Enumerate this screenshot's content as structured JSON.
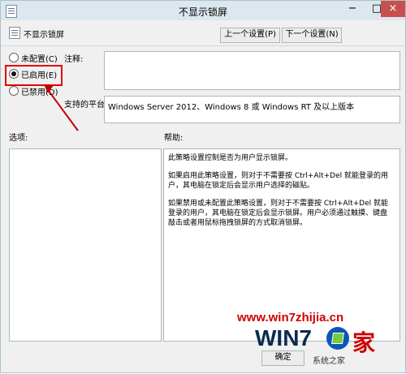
{
  "window": {
    "title": "不显示锁屏"
  },
  "header": {
    "policy_name": "不显示锁屏",
    "prev_button": "上一个设置(P)",
    "next_button": "下一个设置(N)"
  },
  "radios": [
    {
      "label": "未配置(C)",
      "checked": false
    },
    {
      "label": "已启用(E)",
      "checked": true
    },
    {
      "label": "已禁用(D)",
      "checked": false
    }
  ],
  "comment": {
    "label": "注释:",
    "value": ""
  },
  "platform": {
    "label": "支持的平台:",
    "value": "Windows Server 2012、Windows 8 或 Windows RT 及以上版本"
  },
  "options": {
    "label": "选项:"
  },
  "help": {
    "label": "帮助:",
    "paragraphs": [
      "此策略设置控制是否为用户显示锁屏。",
      "如果启用此策略设置，则对于不需要按 Ctrl+Alt+Del 就能登录的用户，其电脑在锁定后会显示用户选择的磁贴。",
      "如果禁用或未配置此策略设置，则对于不需要按 Ctrl+Alt+Del 就能登录的用户，其电脑在锁定后会显示锁屏。用户必须通过触摸、键盘敲击或者用鼠标拖拽锁屏的方式取消锁屏。"
    ]
  },
  "footer": {
    "ok_button": "确定"
  },
  "watermark": {
    "url": "www.win7zhijia.cn",
    "brand": "WIN7",
    "brand_char": "家",
    "small": "系统之家"
  },
  "colors": {
    "highlight": "#e30000",
    "arrow": "#c00000",
    "titlebar": "#dce7ee",
    "close_button": "#c7504f"
  }
}
